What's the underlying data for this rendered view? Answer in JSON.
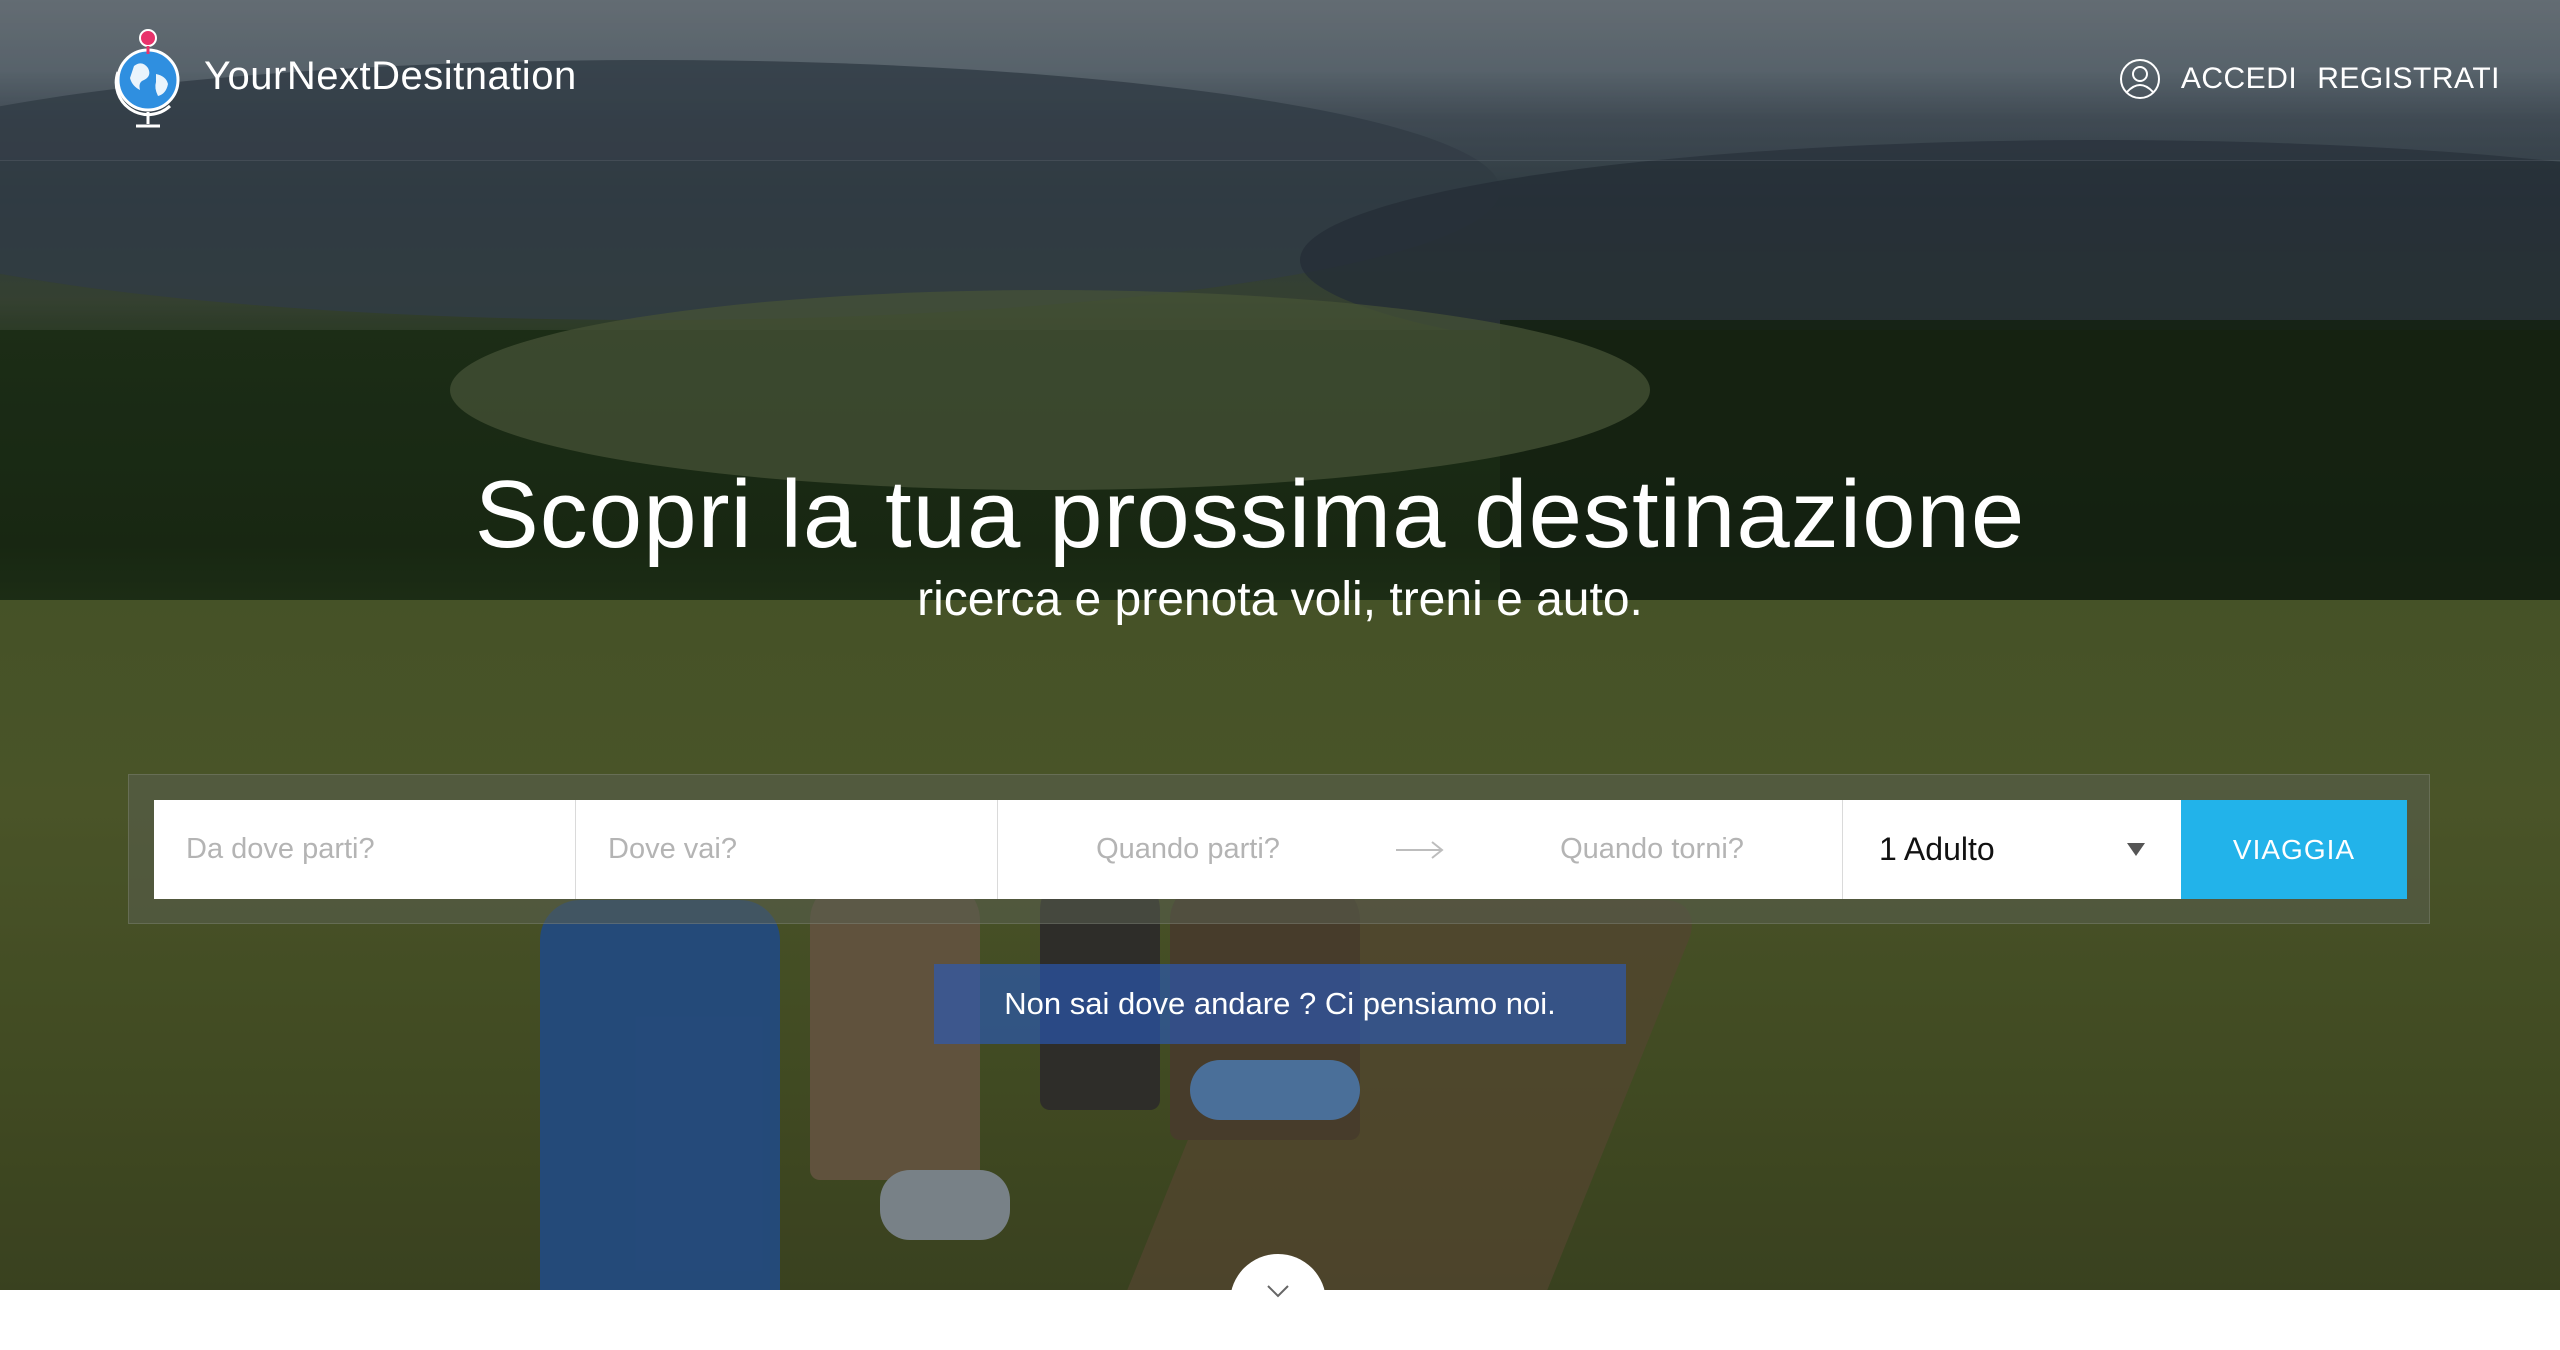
{
  "brand": {
    "name": "YourNextDesitnation"
  },
  "nav": {
    "login": "ACCEDI",
    "register": "REGISTRATI"
  },
  "hero": {
    "title": "Scopri la tua prossima destinazione",
    "subtitle": "ricerca e prenota voli, treni e auto."
  },
  "search": {
    "from_placeholder": "Da dove parti?",
    "to_placeholder": "Dove vai?",
    "depart_placeholder": "Quando parti?",
    "return_placeholder": "Quando torni?",
    "passengers": "1 Adulto",
    "submit": "VIAGGIA"
  },
  "suggest": {
    "text": "Non sai dove andare ? Ci pensiamo noi."
  },
  "colors": {
    "accent": "#22b3ea",
    "suggest_bg": "#285abe"
  },
  "icons": [
    "globe-pin-icon",
    "user-circle-icon",
    "arrow-right-icon",
    "chevron-down-icon"
  ]
}
